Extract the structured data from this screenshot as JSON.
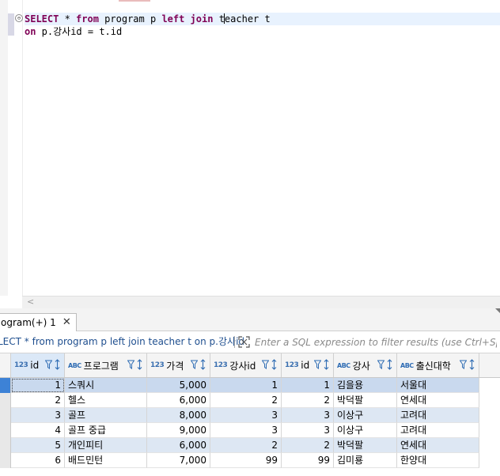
{
  "editor": {
    "line1": {
      "fold": "⊖",
      "t1": "SELECT",
      "t2": " * ",
      "t3": "from",
      "t4": " program p ",
      "t5": "left join",
      "t6": " t",
      "t7": "eacher t"
    },
    "line2": {
      "t1": "on",
      "t2": " p.강사id = t.id"
    },
    "scroll_arrow": "<"
  },
  "result_tab": {
    "label": "ogram(+) 1",
    "close": "✕"
  },
  "filter_bar": {
    "query": "LECT * from program p left join teacher t on p.강사id",
    "placeholder": "Enter a SQL expression to filter results (use Ctrl+Space)"
  },
  "grid": {
    "columns": [
      {
        "type": "123",
        "label": "id"
      },
      {
        "type": "ABC",
        "label": "프로그램"
      },
      {
        "type": "123",
        "label": "가격"
      },
      {
        "type": "123",
        "label": "강사id"
      },
      {
        "type": "123",
        "label": "id"
      },
      {
        "type": "ABC",
        "label": "강사"
      },
      {
        "type": "ABC",
        "label": "출신대학"
      }
    ],
    "rows": [
      [
        "1",
        "스쿼시",
        "5,000",
        "1",
        "1",
        "김을용",
        "서울대"
      ],
      [
        "2",
        "헬스",
        "6,000",
        "2",
        "2",
        "박덕팔",
        "연세대"
      ],
      [
        "3",
        "골프",
        "8,000",
        "3",
        "3",
        "이상구",
        "고려대"
      ],
      [
        "4",
        "골프 중급",
        "9,000",
        "3",
        "3",
        "이상구",
        "고려대"
      ],
      [
        "5",
        "개인피티",
        "6,000",
        "2",
        "2",
        "박덕팔",
        "연세대"
      ],
      [
        "6",
        "배드민턴",
        "7,000",
        "99",
        "99",
        "김미룡",
        "한양대"
      ]
    ]
  },
  "colors": {
    "keyword": "#7f0055",
    "current_line": "#e8f2fe",
    "row_alt": "#dde7f3",
    "selected_row": "#c9d9ee",
    "query_text": "#1f4f8f"
  }
}
